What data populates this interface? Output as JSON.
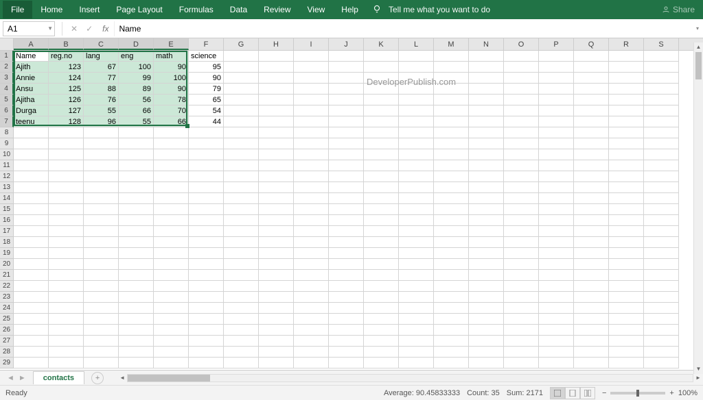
{
  "ribbon": {
    "tabs": [
      "File",
      "Home",
      "Insert",
      "Page Layout",
      "Formulas",
      "Data",
      "Review",
      "View",
      "Help"
    ],
    "tellMe": "Tell me what you want to do",
    "share": "Share"
  },
  "formulaBar": {
    "nameBox": "A1",
    "formula": "Name"
  },
  "columns": [
    "A",
    "B",
    "C",
    "D",
    "E",
    "F",
    "G",
    "H",
    "I",
    "J",
    "K",
    "L",
    "M",
    "N",
    "O",
    "P",
    "Q",
    "R",
    "S"
  ],
  "selectedCols": [
    "A",
    "B",
    "C",
    "D",
    "E"
  ],
  "rowCount": 29,
  "selectedRows": [
    1,
    2,
    3,
    4,
    5,
    6,
    7
  ],
  "sheetData": {
    "headers": [
      "Name",
      "reg.no",
      "lang",
      "eng",
      "math",
      "science"
    ],
    "rows": [
      [
        "Ajith",
        "123",
        "67",
        "100",
        "90",
        "95"
      ],
      [
        "Annie",
        "124",
        "77",
        "99",
        "100",
        "90"
      ],
      [
        "Ansu",
        "125",
        "88",
        "89",
        "90",
        "79"
      ],
      [
        "Ajitha",
        "126",
        "76",
        "56",
        "78",
        "65"
      ],
      [
        "Durga",
        "127",
        "55",
        "66",
        "70",
        "54"
      ],
      [
        "teenu",
        "128",
        "96",
        "55",
        "66",
        "44"
      ]
    ]
  },
  "watermark": "DeveloperPublish.com",
  "sheetTabs": {
    "active": "contacts"
  },
  "statusBar": {
    "ready": "Ready",
    "average": "Average: 90.45833333",
    "count": "Count: 35",
    "sum": "Sum: 2171",
    "zoom": "100%"
  },
  "chart_data": {
    "type": "table",
    "title": "",
    "columns": [
      "Name",
      "reg.no",
      "lang",
      "eng",
      "math",
      "science"
    ],
    "rows": [
      {
        "Name": "Ajith",
        "reg.no": 123,
        "lang": 67,
        "eng": 100,
        "math": 90,
        "science": 95
      },
      {
        "Name": "Annie",
        "reg.no": 124,
        "lang": 77,
        "eng": 99,
        "math": 100,
        "science": 90
      },
      {
        "Name": "Ansu",
        "reg.no": 125,
        "lang": 88,
        "eng": 89,
        "math": 90,
        "science": 79
      },
      {
        "Name": "Ajitha",
        "reg.no": 126,
        "lang": 76,
        "eng": 56,
        "math": 78,
        "science": 65
      },
      {
        "Name": "Durga",
        "reg.no": 127,
        "lang": 55,
        "eng": 66,
        "math": 70,
        "science": 54
      },
      {
        "Name": "teenu",
        "reg.no": 128,
        "lang": 96,
        "eng": 55,
        "math": 66,
        "science": 44
      }
    ]
  }
}
